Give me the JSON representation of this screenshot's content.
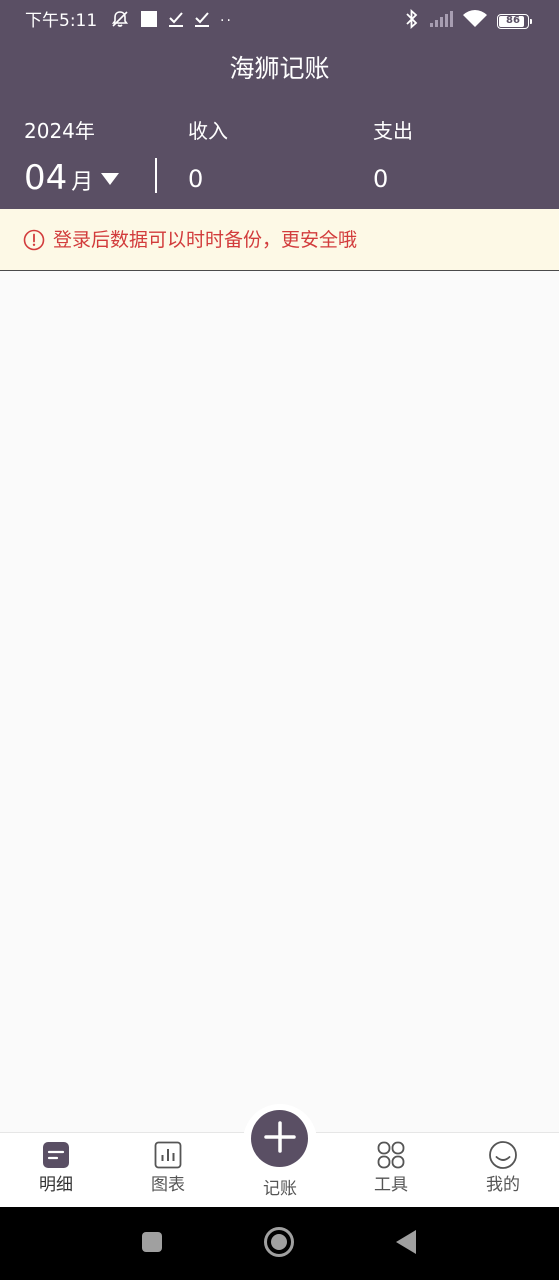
{
  "status_bar": {
    "time": "下午5:11",
    "dots": "··",
    "battery": 86,
    "battery_text": "86"
  },
  "header": {
    "title": "海狮记账",
    "year": "2024年",
    "month": "04",
    "month_unit": "月",
    "income_label": "收入",
    "income_value": "0",
    "expense_label": "支出",
    "expense_value": "0"
  },
  "notice": {
    "text": "登录后数据可以时时备份，更安全哦",
    "icon": "alert-circle-icon",
    "color": "#d23c3c"
  },
  "tabs": [
    {
      "label": "明细",
      "icon": "list-icon",
      "active": true
    },
    {
      "label": "图表",
      "icon": "bar-chart-icon",
      "active": false
    },
    {
      "label": "记账",
      "icon": "plus-icon",
      "active": false
    },
    {
      "label": "工具",
      "icon": "grid-icon",
      "active": false
    },
    {
      "label": "我的",
      "icon": "smile-icon",
      "active": false
    }
  ],
  "colors": {
    "primary": "#5a4f64",
    "notice_bg": "#fdf9e6",
    "content_bg": "#fafafa"
  }
}
